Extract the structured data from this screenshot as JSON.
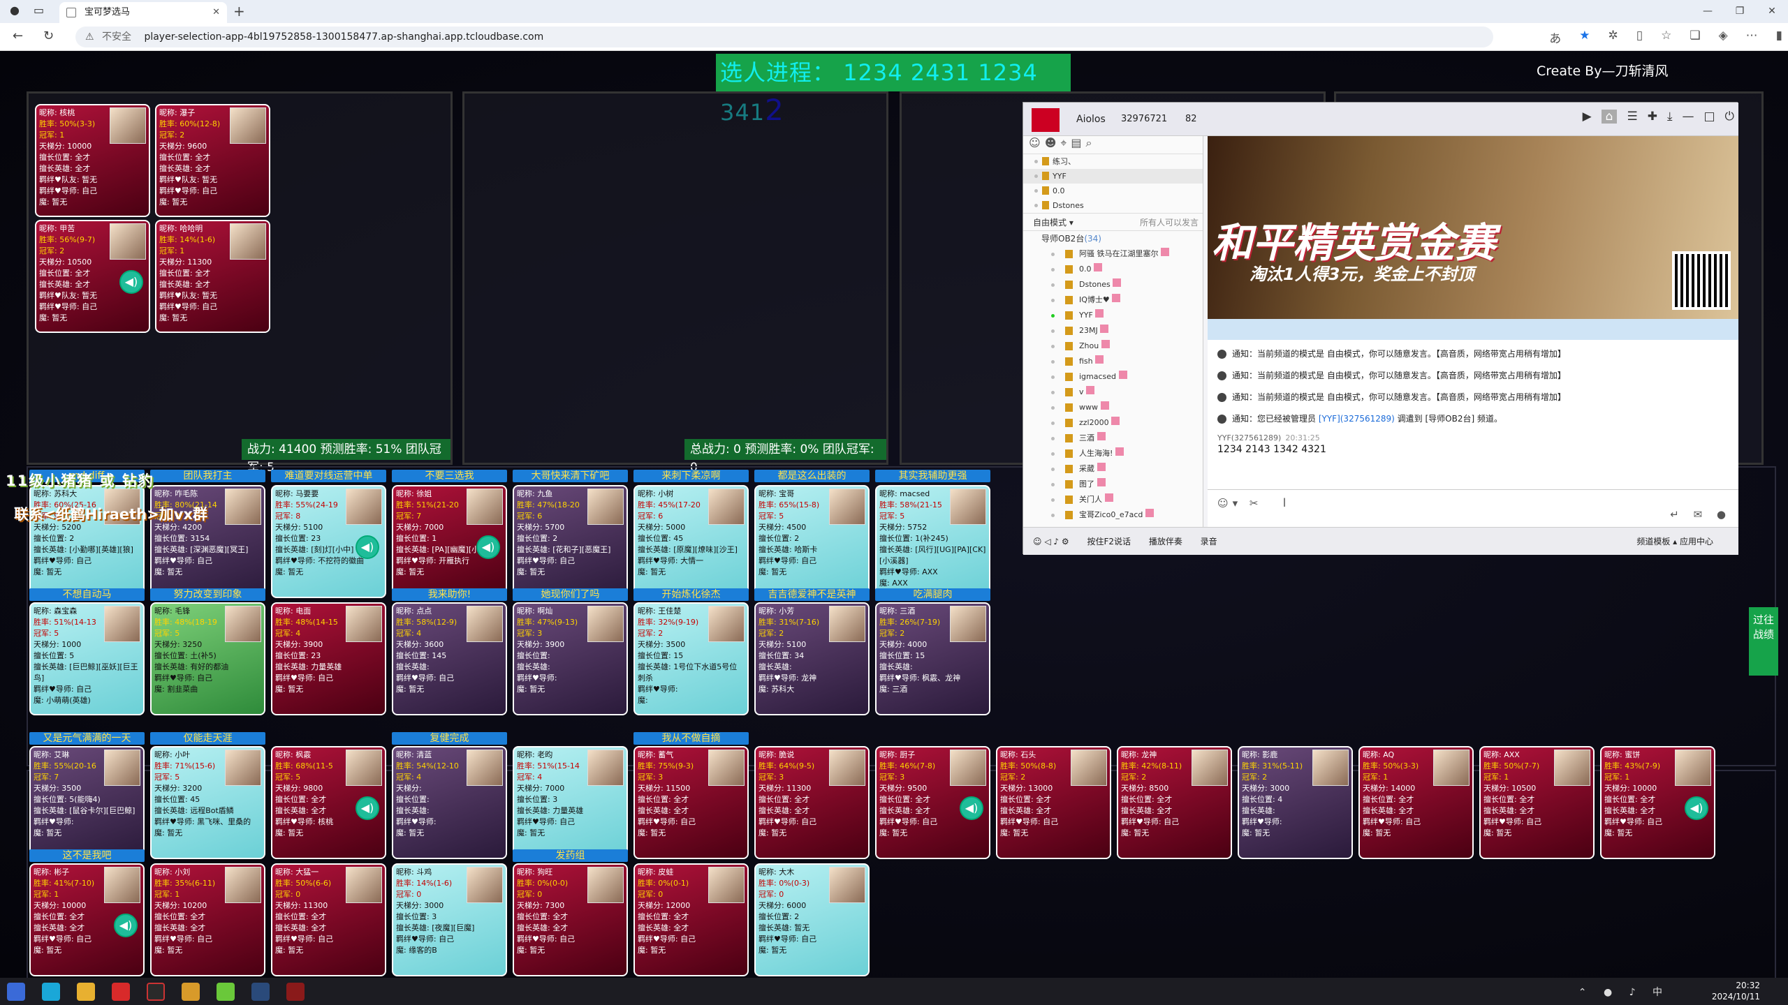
{
  "browser": {
    "tab_title": "宝可梦选马",
    "insecure": "不安全",
    "url": "player-selection-app-4bl19752858-1300158477.ap-shanghai.app.tcloudbase.com"
  },
  "app": {
    "progress_label": "选人进程：",
    "progress_values": "1234 2431 1234 341",
    "progress_last": "2",
    "credit": "Create By—刀斩清风",
    "footer_left": "战力: 41400 预测胜率: 51% 团队冠军: 5",
    "footer_right": "总战力: 0 预测胜率: 0% 团队冠军: 0",
    "overlay_line1": "11级小猪猪 或 钻豹",
    "overlay_line2": "联系<纸鹤Hiraeth>加vx群",
    "side_tab": "过往战绩",
    "labels": {
      "nick": "昵称: ",
      "win": "胜率: ",
      "crown": "冠军: ",
      "score": "天梯分: ",
      "pos": "擅长位置: ",
      "hero": "擅长英雄: ",
      "team": "羁绊♥队友: ",
      "mentor": "羁绊♥导师: ",
      "magic": "魔: "
    }
  },
  "team_cards": [
    {
      "nick": "核桃",
      "win": "50%(3-3)",
      "crown": "1",
      "score": "10000",
      "pos": "全才",
      "hero": "全才",
      "team": "暂无",
      "mentor": "自己",
      "magic": "暂无"
    },
    {
      "nick": "瀑子",
      "win": "60%(12-8)",
      "crown": "2",
      "score": "9600",
      "pos": "全才",
      "hero": "全才",
      "team": "暂无",
      "mentor": "自己",
      "magic": "暂无"
    },
    {
      "nick": "甲苦",
      "win": "56%(9-7)",
      "crown": "2",
      "score": "10500",
      "pos": "全才",
      "hero": "全才",
      "team": "暂无",
      "mentor": "自己",
      "magic": "暂无",
      "mic": true
    },
    {
      "nick": "哈哈明",
      "win": "14%(1-6)",
      "crown": "1",
      "score": "11300",
      "pos": "全才",
      "hero": "全才",
      "team": "暂无",
      "mentor": "自己",
      "magic": "暂无"
    }
  ],
  "row1_banners": [
    "md diff",
    "团队我打主",
    "难道要对线运营中单",
    "不要三选我",
    "大哥快来清下矿吧",
    "来刺下柔凉啊",
    "都是这么出装的",
    "其实我辅助更强"
  ],
  "row1": [
    {
      "nick": "苏科大",
      "win": "60%(25-16",
      "crown": "9",
      "score": "5200",
      "pos": "2",
      "hero": "[小勤哪][英雄][狼]",
      "mentor": "自己",
      "magic": "暂无",
      "style": "cyan"
    },
    {
      "nick": "咋毛陈",
      "win": "80%(21-14",
      "crown": "9",
      "score": "4200",
      "pos": "3154",
      "hero": "[深渊恶魔][冥王]",
      "mentor": "自己",
      "magic": "暂无",
      "style": "pic"
    },
    {
      "nick": "马要要",
      "win": "55%(24-19",
      "crown": "8",
      "score": "5100",
      "pos": "23",
      "hero": "[刻]灯[小中]",
      "mentor": "不挖符的徽曲",
      "magic": "暂无",
      "style": "cyan",
      "mic": true
    },
    {
      "nick": "徐姐",
      "win": "51%(21-20",
      "crown": "7",
      "score": "7000",
      "pos": "1",
      "hero": "[PA][幽魔][小羽]",
      "mentor": "开雁执行",
      "magic": "暂无",
      "style": "red",
      "mic": true
    },
    {
      "nick": "九鱼",
      "win": "47%(18-20",
      "crown": "6",
      "score": "5700",
      "pos": "2",
      "hero": "[花和子][恶魔王]",
      "mentor": "自己",
      "magic": "暂无",
      "style": "pic"
    },
    {
      "nick": "小树",
      "win": "45%(17-20",
      "crown": "6",
      "score": "5000",
      "pos": "45",
      "hero": "[原魔][燎味][沙王]",
      "mentor": "大情一",
      "magic": "暂无",
      "style": "cyan"
    },
    {
      "nick": "宝哥",
      "win": "65%(15-8)",
      "crown": "5",
      "score": "4500",
      "pos": "2",
      "hero": "哈斯卡",
      "mentor": "自己",
      "magic": "暂无",
      "style": "cyan"
    },
    {
      "nick": "macsed",
      "win": "58%(21-15",
      "crown": "5",
      "score": "5752",
      "pos": "1(补245)",
      "hero": "[风行][UG][PA][CK][小溪器]",
      "mentor": "AXX",
      "magic": "AXX",
      "style": "cyan"
    }
  ],
  "row2_banners": [
    "不想自动马",
    "努力改变到印象",
    "",
    "我来助你!",
    "她现你们了吗",
    "开始炼化徐杰",
    "吉吉德爱神不是英神",
    "吃满腿肉"
  ],
  "row2": [
    {
      "nick": "森宝森",
      "win": "51%(14-13",
      "crown": "5",
      "score": "1000",
      "pos": "5",
      "hero": "[巨巴鲸][巫妖][巨王鸟]",
      "mentor": "自己",
      "magic": "小萌萌(英雄)",
      "style": "cyan"
    },
    {
      "nick": "毛锋",
      "win": "48%(18-19",
      "crown": "5",
      "score": "3250",
      "pos": "土(补5)",
      "hero": "有好的都油",
      "mentor": "自己",
      "magic": "割韭菜曲",
      "style": "green"
    },
    {
      "nick": "电面",
      "win": "48%(14-15",
      "crown": "4",
      "score": "3900",
      "pos": "23",
      "hero": "力量英雄",
      "mentor": "自己",
      "magic": "暂无",
      "style": "red"
    },
    {
      "nick": "点点",
      "win": "58%(12-9)",
      "crown": "4",
      "score": "3600",
      "pos": "145",
      "hero": "",
      "mentor": "自己",
      "magic": "暂无",
      "style": "pic"
    },
    {
      "nick": "啊灿",
      "win": "47%(9-13)",
      "crown": "3",
      "score": "3900",
      "pos": "",
      "hero": "",
      "mentor": "",
      "magic": "暂无",
      "style": "pic"
    },
    {
      "nick": "王佳楚",
      "win": "32%(9-19)",
      "crown": "2",
      "score": "3500",
      "pos": "15",
      "hero": "1号位下水道5号位刺杀",
      "mentor": "",
      "magic": "",
      "style": "cyan"
    },
    {
      "nick": "小芳",
      "win": "31%(7-16)",
      "crown": "2",
      "score": "5100",
      "pos": "34",
      "hero": "",
      "mentor": "龙神",
      "magic": "苏科大",
      "style": "pic"
    },
    {
      "nick": "三酒",
      "win": "26%(7-19)",
      "crown": "2",
      "score": "4000",
      "pos": "15",
      "hero": "",
      "mentor": "枫霰、龙神",
      "magic": "三酒",
      "style": "pic"
    }
  ],
  "row3_banners": [
    "又是元气满满的一天",
    "仅能走天涯",
    "",
    "复健完成",
    "",
    "我从不做自摘"
  ],
  "row3": [
    {
      "nick": "艾琳",
      "win": "55%(20-16",
      "crown": "7",
      "score": "3500",
      "pos": "5(能嗨4)",
      "hero": "[鼠谷卡尔][巨巴鲸]",
      "mentor": "",
      "magic": "暂无",
      "style": "pic"
    },
    {
      "nick": "小叶",
      "win": "71%(15-6)",
      "crown": "5",
      "score": "3200",
      "pos": "45",
      "hero": "远程Bot盾鳞",
      "mentor": "黑飞咪、里桑的",
      "magic": "暂无",
      "style": "cyan"
    },
    {
      "nick": "枫霰",
      "win": "68%(11-5",
      "crown": "5",
      "score": "9800",
      "pos": "全才",
      "hero": "全才",
      "mentor": "核桃",
      "magic": "暂无",
      "style": "red",
      "mic": true
    },
    {
      "nick": "清蓝",
      "win": "54%(12-10",
      "crown": "4",
      "score": "",
      "pos": "",
      "hero": "",
      "mentor": "",
      "magic": "暂无",
      "style": "pic"
    },
    {
      "nick": "老昀",
      "win": "51%(15-14",
      "crown": "4",
      "score": "7000",
      "pos": "3",
      "hero": "力量英雄",
      "mentor": "自己",
      "magic": "暂无",
      "style": "cyan"
    },
    {
      "nick": "蓄气",
      "win": "75%(9-3)",
      "crown": "3",
      "score": "11500",
      "pos": "全才",
      "hero": "全才",
      "mentor": "自己",
      "magic": "暂无",
      "style": "red"
    },
    {
      "nick": "脆说",
      "win": "64%(9-5)",
      "crown": "3",
      "score": "11300",
      "pos": "全才",
      "hero": "全才",
      "mentor": "自己",
      "magic": "暂无",
      "style": "red"
    },
    {
      "nick": "厨子",
      "win": "46%(7-8)",
      "crown": "3",
      "score": "9500",
      "pos": "全才",
      "hero": "全才",
      "mentor": "自己",
      "magic": "暂无",
      "style": "red",
      "mic": true
    },
    {
      "nick": "石头",
      "win": "50%(8-8)",
      "crown": "2",
      "score": "13000",
      "pos": "全才",
      "hero": "全才",
      "mentor": "自己",
      "magic": "暂无",
      "style": "red"
    },
    {
      "nick": "龙神",
      "win": "42%(8-11)",
      "crown": "2",
      "score": "8500",
      "pos": "全才",
      "hero": "全才",
      "mentor": "自己",
      "magic": "暂无",
      "style": "red"
    },
    {
      "nick": "影鹿",
      "win": "31%(5-11)",
      "crown": "2",
      "score": "3000",
      "pos": "4",
      "hero": "",
      "mentor": "",
      "magic": "暂无",
      "style": "pic"
    },
    {
      "nick": "AQ",
      "win": "50%(3-3)",
      "crown": "1",
      "score": "14000",
      "pos": "全才",
      "hero": "全才",
      "mentor": "自己",
      "magic": "暂无",
      "style": "red"
    },
    {
      "nick": "AXX",
      "win": "50%(7-7)",
      "crown": "1",
      "score": "10500",
      "pos": "全才",
      "hero": "全才",
      "mentor": "自己",
      "magic": "暂无",
      "style": "red"
    },
    {
      "nick": "蜜饼",
      "win": "43%(7-9)",
      "crown": "1",
      "score": "10000",
      "pos": "全才",
      "hero": "全才",
      "mentor": "自己",
      "magic": "暂无",
      "style": "red",
      "mic": true
    }
  ],
  "row4_banners": [
    "这不是我吧",
    "",
    "",
    "",
    "发药组"
  ],
  "row4": [
    {
      "nick": "彬子",
      "win": "41%(7-10)",
      "crown": "1",
      "score": "10000",
      "pos": "全才",
      "hero": "全才",
      "mentor": "自己",
      "magic": "暂无",
      "style": "red",
      "mic": true
    },
    {
      "nick": "小刘",
      "win": "35%(6-11)",
      "crown": "1",
      "score": "10200",
      "pos": "全才",
      "hero": "全才",
      "mentor": "自己",
      "magic": "暂无",
      "style": "red"
    },
    {
      "nick": "大猛一",
      "win": "50%(6-6)",
      "crown": "0",
      "score": "11300",
      "pos": "全才",
      "hero": "全才",
      "mentor": "自己",
      "magic": "暂无",
      "style": "red"
    },
    {
      "nick": "斗鸡",
      "win": "14%(1-6)",
      "crown": "0",
      "score": "3000",
      "pos": "3",
      "hero": "[夜魔][巨魔]",
      "mentor": "自己",
      "magic": "缘客的B",
      "style": "cyan"
    },
    {
      "nick": "狗旺",
      "win": "0%(0-0)",
      "crown": "0",
      "score": "7300",
      "pos": "全才",
      "hero": "全才",
      "mentor": "自己",
      "magic": "暂无",
      "style": "red"
    },
    {
      "nick": "皮蛙",
      "win": "0%(0-1)",
      "crown": "0",
      "score": "12000",
      "pos": "全才",
      "hero": "全才",
      "mentor": "自己",
      "magic": "暂无",
      "style": "red"
    },
    {
      "nick": "大木",
      "win": "0%(0-3)",
      "crown": "0",
      "score": "6000",
      "pos": "2",
      "hero": "暂无",
      "mentor": "自己",
      "magic": "暂无",
      "style": "cyan"
    }
  ],
  "voice": {
    "user": "Aiolos",
    "room": "32976721",
    "users": "82",
    "top_rooms": [
      "练习、",
      "YYF",
      "0.0",
      "Dstones"
    ],
    "mode": "自由模式",
    "mode_hint": "所有人可以发言",
    "group": "导师OB2台",
    "group_count": "(34)",
    "members": [
      "阿骚 铁马在江湖里塞尔",
      "0.0",
      "Dstones",
      "IQ博士♥",
      "YYF",
      "23MJ",
      "Zhou",
      "fish",
      "igmacsed",
      "v",
      "www",
      "zzl2000",
      "三酒",
      "人生海海!",
      "采葳",
      "图了",
      "关门人",
      "宝哥Zico0_e7acd"
    ],
    "ad_title": "和平精英赏金赛",
    "ad_sub": "淘汰1人得3元，奖金上不封顶",
    "notices": [
      "通知：当前频道的模式是 自由模式，你可以随意发言。【高音质，网络带宽占用稍有增加】",
      "通知：当前频道的模式是 自由模式，你可以随意发言。【高音质，网络带宽占用稍有增加】",
      "通知：当前频道的模式是 自由模式，你可以随意发言。【高音质，网络带宽占用稍有增加】"
    ],
    "notice4_pre": "通知：您已经被管理员 ",
    "notice4_hl": "[YYF](327561289)",
    "notice4_post": " 调遣到 [导师OB2台] 频道。",
    "msg_user": "YYF(327561289)",
    "msg_time": "20:31:25",
    "msg_body": "1234 2143 1342 4321",
    "bottom": [
      "按住F2说话",
      "播放伴奏",
      "录音"
    ],
    "bottom_right": "频道模板 ▴  应用中心"
  },
  "taskbar": {
    "time": "20:32",
    "date": "2024/10/11",
    "lang": "中"
  }
}
